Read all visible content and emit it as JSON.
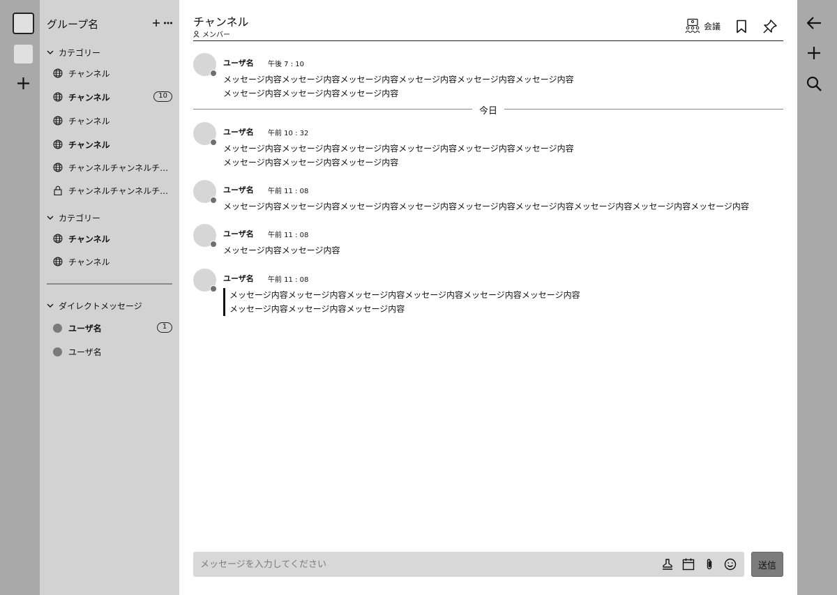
{
  "rail": {
    "workspaces": [
      "workspace-active",
      "workspace"
    ],
    "add_icon": "plus-icon"
  },
  "sidebar": {
    "group_name": "グループ名",
    "categories": [
      {
        "label": "カテゴリー",
        "channels": [
          {
            "label": "チャンネル",
            "icon": "globe-icon",
            "bold": false,
            "badge": ""
          },
          {
            "label": "チャンネル",
            "icon": "globe-icon",
            "bold": true,
            "badge": "10"
          },
          {
            "label": "チャンネル",
            "icon": "globe-icon",
            "bold": false,
            "badge": ""
          },
          {
            "label": "チャンネル",
            "icon": "globe-icon",
            "bold": true,
            "badge": ""
          },
          {
            "label": "チャンネルチャンネルチャ…",
            "icon": "globe-icon",
            "bold": false,
            "badge": ""
          },
          {
            "label": "チャンネルチャンネルチャ…",
            "icon": "lock-icon",
            "bold": false,
            "badge": ""
          }
        ]
      },
      {
        "label": "カテゴリー",
        "channels": [
          {
            "label": "チャンネル",
            "icon": "globe-icon",
            "bold": true,
            "badge": ""
          },
          {
            "label": "チャンネル",
            "icon": "globe-icon",
            "bold": false,
            "badge": ""
          }
        ]
      }
    ],
    "dm_section": {
      "label": "ダイレクトメッセージ",
      "users": [
        {
          "label": "ユーザ名",
          "bold": true,
          "badge": "1"
        },
        {
          "label": "ユーザ名",
          "bold": false,
          "badge": ""
        }
      ]
    }
  },
  "header": {
    "channel_name": "チャンネル",
    "members_label": "メンバー",
    "meeting_label": "会議"
  },
  "messages": [
    {
      "user": "ユーザ名",
      "time": "午後 7 : 10",
      "lines": [
        "メッセージ内容メッセージ内容メッセージ内容メッセージ内容メッセージ内容メッセージ内容",
        "メッセージ内容メッセージ内容メッセージ内容"
      ],
      "quote": false
    },
    {
      "user": "ユーザ名",
      "time": "午前 10 : 32",
      "lines": [
        "メッセージ内容メッセージ内容メッセージ内容メッセージ内容メッセージ内容メッセージ内容",
        "メッセージ内容メッセージ内容メッセージ内容"
      ],
      "quote": false
    },
    {
      "user": "ユーザ名",
      "time": "午前 11 : 08",
      "lines": [
        "メッセージ内容メッセージ内容メッセージ内容メッセージ内容メッセージ内容メッセージ内容メッセージ内容メッセージ内容メッセージ内容"
      ],
      "quote": false
    },
    {
      "user": "ユーザ名",
      "time": "午前 11 : 08",
      "lines": [
        "メッセージ内容メッセージ内容"
      ],
      "quote": false
    },
    {
      "user": "ユーザ名",
      "time": "午前 11 : 08",
      "lines": [
        "メッセージ内容メッセージ内容メッセージ内容メッセージ内容メッセージ内容メッセージ内容",
        "メッセージ内容メッセージ内容メッセージ内容"
      ],
      "quote": true
    }
  ],
  "date_separator": "今日",
  "composer": {
    "placeholder": "メッセージを入力してください",
    "icons": [
      "stamp-icon",
      "calendar-icon",
      "paperclip-icon",
      "emoji-icon"
    ],
    "send_label": "送信"
  },
  "right_rail": {
    "icons": [
      "back-arrow-icon",
      "plus-icon",
      "search-icon"
    ]
  },
  "colors": {
    "rail_bg": "#a9a9a9",
    "sidebar_bg": "#d2d2d2",
    "main_bg": "#ffffff",
    "send_bg": "#7c7c7c",
    "composer_bg": "#d8d8d8"
  }
}
